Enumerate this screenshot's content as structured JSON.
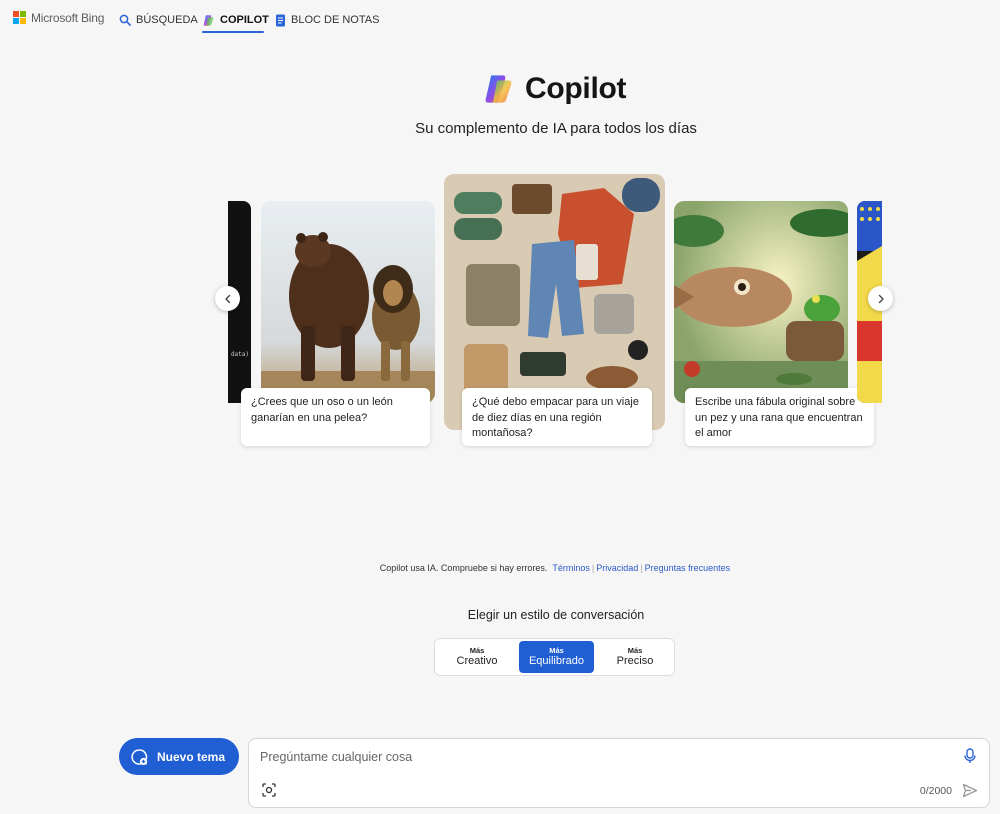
{
  "nav": {
    "brand": "Microsoft Bing",
    "tabs": [
      {
        "label": "BÚSQUEDA",
        "icon": "search-icon"
      },
      {
        "label": "COPILOT",
        "icon": "copilot-icon",
        "active": true
      },
      {
        "label": "BLOC DE NOTAS",
        "icon": "notebook-icon"
      }
    ]
  },
  "hero": {
    "title": "Copilot",
    "tagline": "Su complemento de IA para todos los días"
  },
  "carousel": {
    "cards": [
      {
        "caption": "¿Crees que un oso o un león ganarían en una pelea?",
        "image": "bear-and-lion"
      },
      {
        "caption": "¿Qué debo empacar para un viaje de diez días en una región montañosa?",
        "image": "packing-flatlay"
      },
      {
        "caption": "Escribe una fábula original sobre un pez y una rana que encuentran el amor",
        "image": "fish-and-frog"
      }
    ],
    "edge_code_text": "data)"
  },
  "disclaimer": {
    "text": "Copilot usa IA. Compruebe si hay errores.",
    "links": [
      "Términos",
      "Privacidad",
      "Preguntas frecuentes"
    ]
  },
  "style_picker": {
    "label": "Elegir un estilo de conversación",
    "options": [
      {
        "small": "Más",
        "large": "Creativo"
      },
      {
        "small": "Más",
        "large": "Equilibrado",
        "active": true
      },
      {
        "small": "Más",
        "large": "Preciso"
      }
    ]
  },
  "composer": {
    "new_topic_label": "Nuevo tema",
    "placeholder": "Pregúntame cualquier cosa",
    "counter": "0/2000"
  },
  "colors": {
    "accent": "#1f5fd3",
    "link": "#2b5bc8",
    "background": "#f6f6f6"
  }
}
